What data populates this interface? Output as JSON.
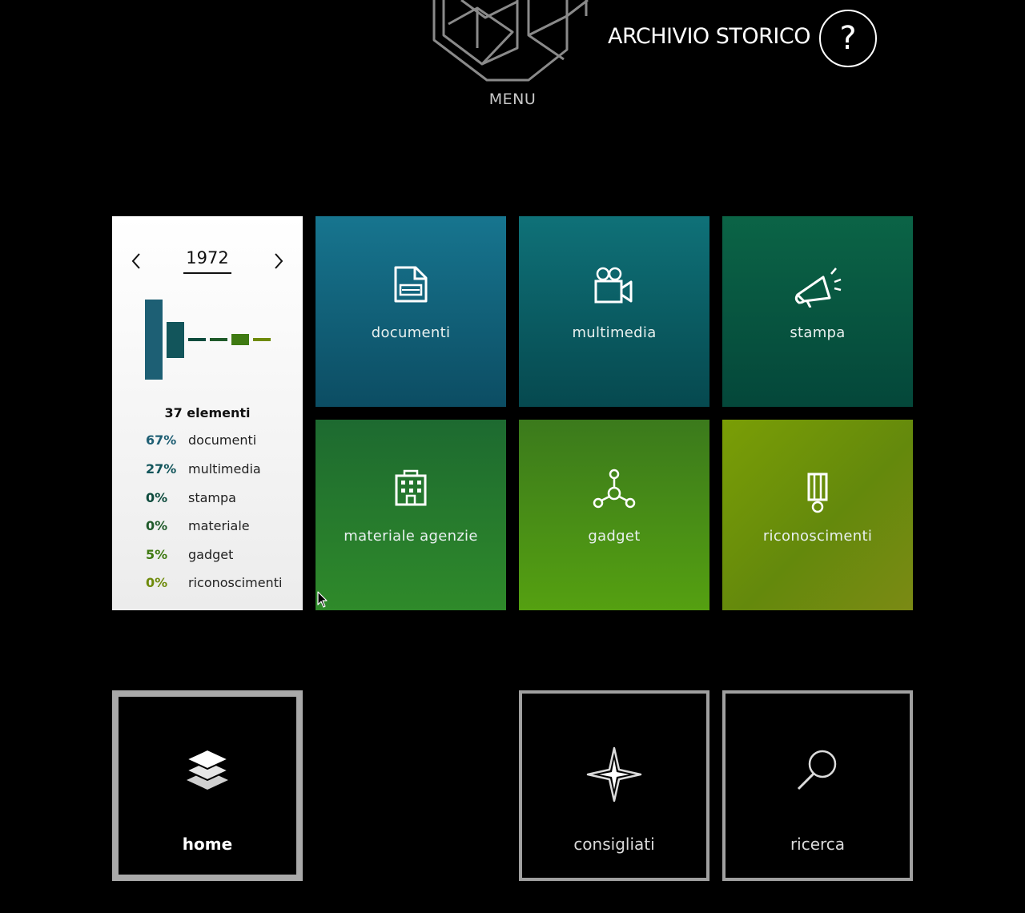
{
  "header": {
    "menu_label": "MENU",
    "app_title": "ARCHIVIO STORICO",
    "help_label": "?"
  },
  "stats": {
    "year": "1972",
    "elements_count": "37 elementi",
    "rows": [
      {
        "pct": "67%",
        "name": "documenti",
        "color": "#1e5e73"
      },
      {
        "pct": "27%",
        "name": "multimedia",
        "color": "#12555b"
      },
      {
        "pct": "0%",
        "name": "stampa",
        "color": "#0e4b3d"
      },
      {
        "pct": "0%",
        "name": "materiale",
        "color": "#1f5a2a"
      },
      {
        "pct": "5%",
        "name": "gadget",
        "color": "#3f7a12"
      },
      {
        "pct": "0%",
        "name": "riconoscimenti",
        "color": "#6e8a0a"
      }
    ]
  },
  "categories": [
    {
      "label": "documenti",
      "icon": "document-icon"
    },
    {
      "label": "multimedia",
      "icon": "video-camera-icon"
    },
    {
      "label": "stampa",
      "icon": "megaphone-icon"
    },
    {
      "label": "materiale agenzie",
      "icon": "building-icon"
    },
    {
      "label": "gadget",
      "icon": "network-nodes-icon"
    },
    {
      "label": "riconoscimenti",
      "icon": "medal-ribbon-icon"
    }
  ],
  "nav": {
    "home_label": "home",
    "consigliati_label": "consigliati",
    "ricerca_label": "ricerca"
  }
}
